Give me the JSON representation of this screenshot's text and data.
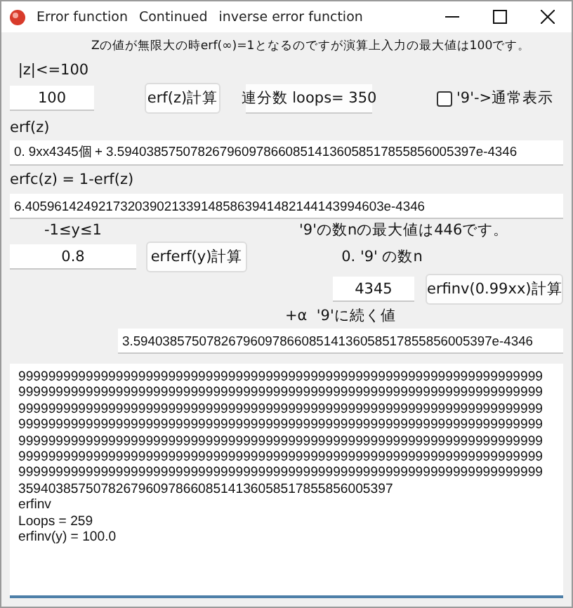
{
  "window": {
    "title_parts": [
      "Error function",
      "Continued",
      "inverse error function"
    ]
  },
  "note": "Zの値が無限大の時erf(∞)=1となるのですが演算上入力の最大値は100です。",
  "z": {
    "label": "|z|<=100",
    "value": "100"
  },
  "erf_button": "erf(z)計算",
  "loops": "連分数 loops= 350",
  "normal_display": {
    "label": "'9'->通常表示",
    "checked": false
  },
  "erf": {
    "label": "erf(z)",
    "value": "0. 9xx4345個 + 3.5940385750782679609786608514136058517855856005397e-4346"
  },
  "erfc": {
    "label": "erfc(z) = 1-erf(z)",
    "value": "6.4059614249217320390213391485863941482144143994603e-4346"
  },
  "y": {
    "label": "-1≤y≤1",
    "value": "0.8"
  },
  "erferf_button": "erferf(y)計算",
  "n_max_note": "'9'の数nの最大値は446です。",
  "n": {
    "label": "0. '9' の数n",
    "value": "4345"
  },
  "erfinv_button": "erfinv(0.99xx)計算",
  "alpha": {
    "label": "+α  '9'に続く値",
    "value": "3.5940385750782679609786608514136058517855856005397e-4346"
  },
  "output": [
    "9999999999999999999999999999999999999999999999999999999999999999999999",
    "9999999999999999999999999999999999999999999999999999999999999999999999",
    "9999999999999999999999999999999999999999999999999999999999999999999999",
    "9999999999999999999999999999999999999999999999999999999999999999999999",
    "9999999999999999999999999999999999999999999999999999999999999999999999",
    "9999999999999999999999999999999999999999999999999999999999999999999999",
    "9999999999999999999999999999999999999999999999999999999999999999999999",
    "35940385750782679609786608514136058517855856005397",
    "erfinv",
    "Loops = 259",
    "erfinv(y) = 100.0"
  ]
}
